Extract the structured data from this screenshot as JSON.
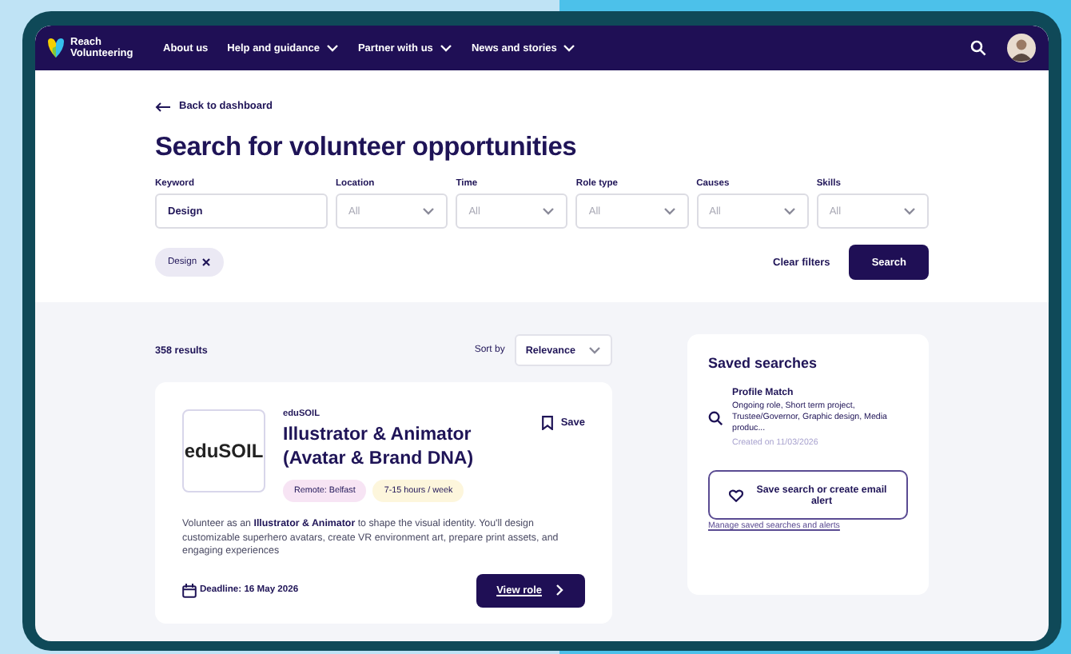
{
  "nav": {
    "brand": "Reach Volunteering",
    "items": [
      {
        "label": "About us",
        "dropdown": false
      },
      {
        "label": "Help and guidance",
        "dropdown": true
      },
      {
        "label": "Partner with us",
        "dropdown": true
      },
      {
        "label": "News and stories",
        "dropdown": true
      }
    ]
  },
  "back_link": "Back to dashboard",
  "title": "Search for volunteer opportunities",
  "filters": [
    {
      "kind": "text",
      "label": "Keyword",
      "value": "Design"
    },
    {
      "kind": "select",
      "label": "Location",
      "placeholder": "All"
    },
    {
      "kind": "select",
      "label": "Time",
      "placeholder": "All"
    },
    {
      "kind": "select",
      "label": "Role type",
      "placeholder": "All"
    },
    {
      "kind": "select",
      "label": "Causes",
      "placeholder": "All"
    },
    {
      "kind": "select",
      "label": "Skills",
      "placeholder": "All"
    }
  ],
  "chips": [
    {
      "label": "Design"
    }
  ],
  "clear_filters": "Clear filters",
  "search_button": "Search",
  "results_count": "358 results",
  "sort": {
    "label": "Sort by",
    "value": "Relevance"
  },
  "cards": [
    {
      "logo_text": "eduSOIL",
      "org": "eduSOIL",
      "title": "Illustrator & Animator (Avatar & Brand DNA)",
      "save": "Save",
      "tags": [
        {
          "text": "Remote: Belfast",
          "color": "#f7e4f4"
        },
        {
          "text": "7-15 hours / week",
          "color": "#fdf6dc"
        }
      ],
      "description": "Volunteer as an **Illustrator & Animator** to shape the visual identity. You'll design customizable superhero avatars, create VR environment art, prepare print assets, and engaging experiences",
      "deadline": "Deadline: 16 May 2026",
      "view_button": "View role"
    }
  ],
  "saved_searches": {
    "title": "Saved searches",
    "items": [
      {
        "name": "Profile Match",
        "details": "Ongoing role, Short term project, Trustee/Governor, Graphic design, Media produc...",
        "created": "Created on 11/03/2026"
      }
    ],
    "save_button": "Save search or create email alert",
    "manage_link": "Manage saved searches and alerts"
  }
}
